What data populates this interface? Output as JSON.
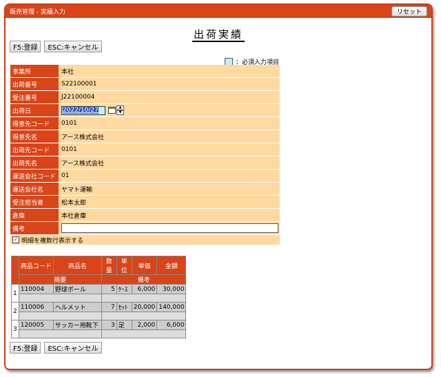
{
  "window": {
    "title": "販売管理 - 実績入力",
    "reset_label": "リセット"
  },
  "page_title": "出荷実績",
  "toolbar": {
    "register_label": "F5:登録",
    "cancel_label": "ESC:キャンセル"
  },
  "legend": {
    "label": "：必須入力項目",
    "required_color": "#bfeffc"
  },
  "form": {
    "fields": [
      {
        "label": "事業所",
        "value": "本社"
      },
      {
        "label": "出荷番号",
        "value": "S22100001"
      },
      {
        "label": "受注番号",
        "value": "J22100004"
      },
      {
        "label": "出荷日",
        "value": "2022/10/27"
      },
      {
        "label": "得意先コード",
        "value": "0101"
      },
      {
        "label": "得意先名",
        "value": "アース株式会社"
      },
      {
        "label": "出荷先コード",
        "value": "0101"
      },
      {
        "label": "出荷先名",
        "value": "アース株式会社"
      },
      {
        "label": "運送会社コード",
        "value": "01"
      },
      {
        "label": "運送会社名",
        "value": "ヤマト運輸"
      },
      {
        "label": "受注担当者",
        "value": "松本太郎"
      },
      {
        "label": "倉庫",
        "value": "本社倉庫"
      },
      {
        "label": "備考",
        "value": ""
      }
    ],
    "multi_line_label": "明細を複数行表示する",
    "multi_line_checked": true
  },
  "detail": {
    "headers": [
      "商品コード",
      "商品名",
      "数量",
      "単位",
      "単価",
      "金額"
    ],
    "sub_headers": [
      "摘要",
      "備考"
    ],
    "rows": [
      {
        "no": "1",
        "code": "110004",
        "name": "野球ボール",
        "qty": "5",
        "unit": "ｹｰｽ",
        "price": "6,000",
        "amount": "30,000"
      },
      {
        "no": "2",
        "code": "110006",
        "name": "ヘルメット",
        "qty": "7",
        "unit": "ｾｯﾄ",
        "price": "20,000",
        "amount": "140,000"
      },
      {
        "no": "3",
        "code": "120005",
        "name": "サッカー用靴下",
        "qty": "3",
        "unit": "足",
        "price": "2,000",
        "amount": "6,000"
      }
    ]
  },
  "colors": {
    "accent": "#d94418",
    "field_bg": "#ffd9a0",
    "row_bg": "#cdcdcd"
  }
}
